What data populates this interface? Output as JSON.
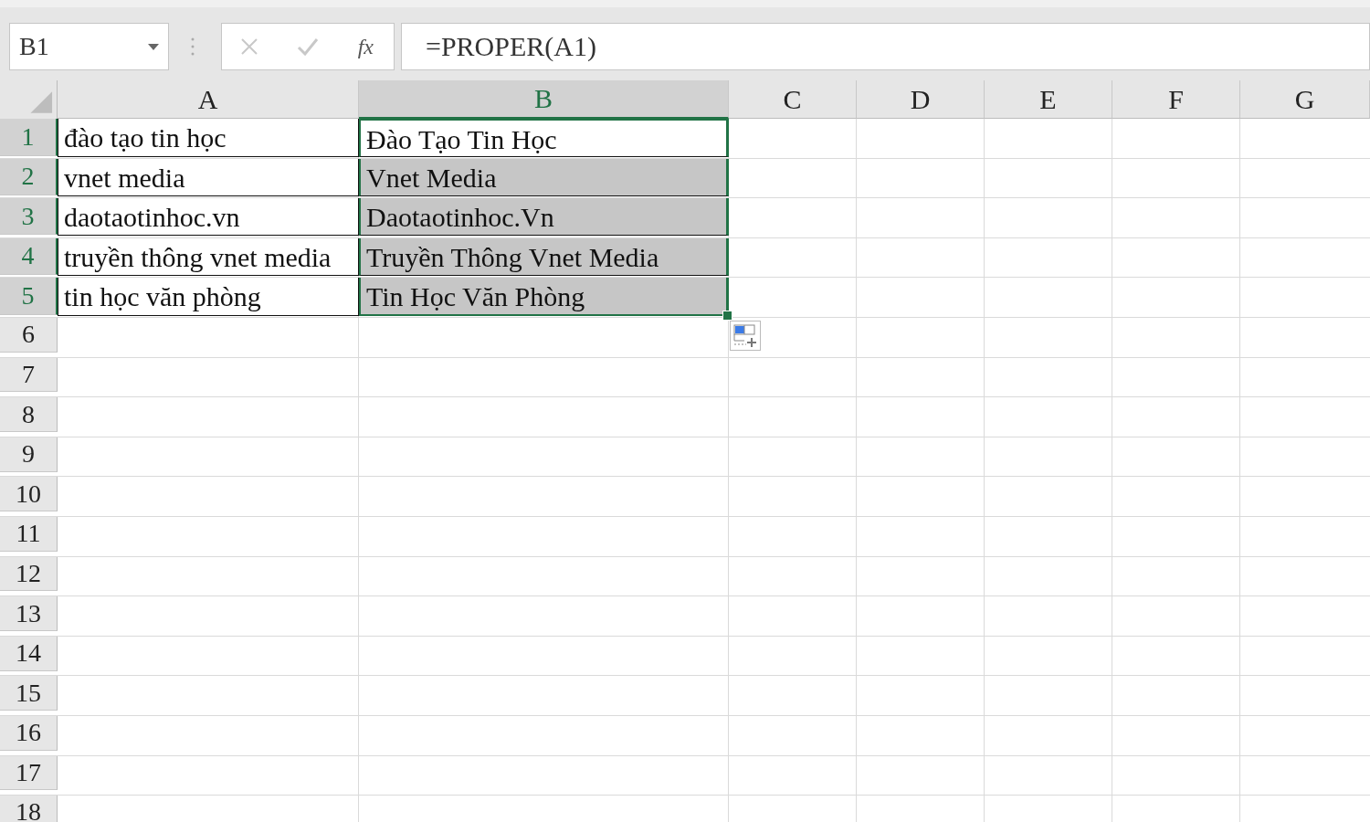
{
  "formula_bar": {
    "name_box": "B1",
    "insert_function": "fx",
    "formula": "=PROPER(A1)",
    "cancel_disabled": true,
    "enter_disabled": true
  },
  "columns": [
    {
      "label": "A",
      "selected": false
    },
    {
      "label": "B",
      "selected": true
    },
    {
      "label": "C",
      "selected": false
    },
    {
      "label": "D",
      "selected": false
    },
    {
      "label": "E",
      "selected": false
    },
    {
      "label": "F",
      "selected": false
    },
    {
      "label": "G",
      "selected": false
    }
  ],
  "rows": [
    {
      "number": "1",
      "selected": true,
      "cells": [
        {
          "text": "đào tạo tin học",
          "bordered": true,
          "selected": false,
          "active": false
        },
        {
          "text": "Đào Tạo Tin Học",
          "bordered": true,
          "selected": true,
          "active": true
        }
      ]
    },
    {
      "number": "2",
      "selected": true,
      "cells": [
        {
          "text": "vnet media",
          "bordered": true,
          "selected": false,
          "active": false
        },
        {
          "text": "Vnet Media",
          "bordered": true,
          "selected": true,
          "active": false
        }
      ]
    },
    {
      "number": "3",
      "selected": true,
      "cells": [
        {
          "text": "daotaotinhoc.vn",
          "bordered": true,
          "selected": false,
          "active": false
        },
        {
          "text": "Daotaotinhoc.Vn",
          "bordered": true,
          "selected": true,
          "active": false
        }
      ]
    },
    {
      "number": "4",
      "selected": true,
      "cells": [
        {
          "text": "truyền thông vnet media",
          "bordered": true,
          "selected": false,
          "active": false
        },
        {
          "text": "Truyền Thông Vnet Media",
          "bordered": true,
          "selected": true,
          "active": false
        }
      ]
    },
    {
      "number": "5",
      "selected": true,
      "cells": [
        {
          "text": "tin học văn phòng",
          "bordered": true,
          "selected": false,
          "active": false
        },
        {
          "text": "Tin Học Văn Phòng",
          "bordered": true,
          "selected": true,
          "active": false
        }
      ]
    },
    {
      "number": "6",
      "selected": false,
      "cells": []
    },
    {
      "number": "7",
      "selected": false,
      "cells": []
    },
    {
      "number": "8",
      "selected": false,
      "cells": []
    },
    {
      "number": "9",
      "selected": false,
      "cells": []
    },
    {
      "number": "10",
      "selected": false,
      "cells": []
    },
    {
      "number": "11",
      "selected": false,
      "cells": []
    },
    {
      "number": "12",
      "selected": false,
      "cells": []
    },
    {
      "number": "13",
      "selected": false,
      "cells": []
    },
    {
      "number": "14",
      "selected": false,
      "cells": []
    },
    {
      "number": "15",
      "selected": false,
      "cells": []
    },
    {
      "number": "16",
      "selected": false,
      "cells": []
    },
    {
      "number": "17",
      "selected": false,
      "cells": []
    },
    {
      "number": "18",
      "selected": false,
      "cells": []
    }
  ]
}
